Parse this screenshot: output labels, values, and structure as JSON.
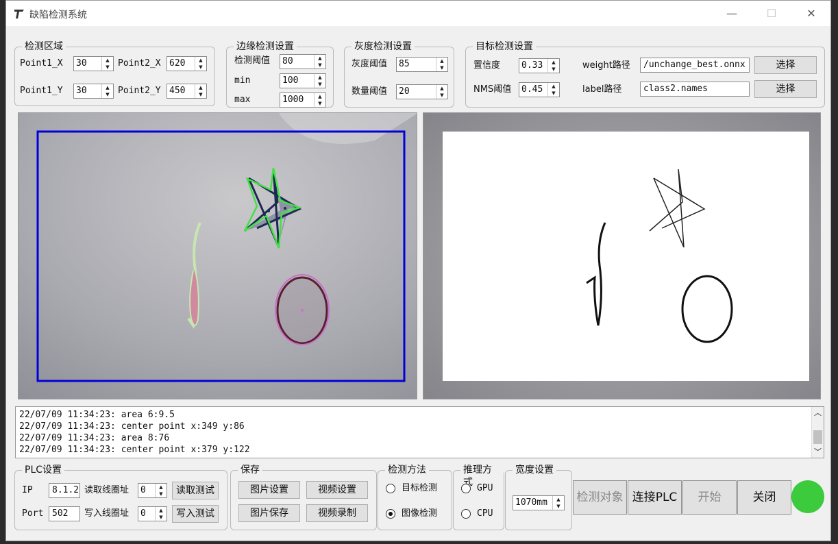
{
  "window": {
    "title": "缺陷检测系统",
    "min_glyph": "—",
    "max_glyph": "☐",
    "close_glyph": "✕"
  },
  "region": {
    "title": "检测区域",
    "p1x_label": "Point1_X",
    "p1x_value": "30",
    "p2x_label": "Point2_X",
    "p2x_value": "620",
    "p1y_label": "Point1_Y",
    "p1y_value": "30",
    "p2y_label": "Point2_Y",
    "p2y_value": "450"
  },
  "edge": {
    "title": "边缘检测设置",
    "thresh_label": "检测阈值",
    "thresh_value": "80",
    "min_label": "min",
    "min_value": "100",
    "max_label": "max",
    "max_value": "1000"
  },
  "gray": {
    "title": "灰度检测设置",
    "thresh_label": "灰度阈值",
    "thresh_value": "85",
    "count_label": "数量阈值",
    "count_value": "20"
  },
  "target": {
    "title": "目标检测设置",
    "conf_label": "置信度",
    "conf_value": "0.33",
    "nms_label": "NMS阈值",
    "nms_value": "0.45",
    "weight_label": "weight路径",
    "weight_value": "/unchange_best.onnx",
    "label_label": "label路径",
    "label_value": "class2.names",
    "select_label": "选择"
  },
  "log": {
    "lines": [
      "22/07/09 11:34:23: area 6:9.5",
      "22/07/09 11:34:23: center point x:349 y:86",
      "22/07/09 11:34:23: area 8:76",
      "22/07/09 11:34:23: center point x:379 y:122"
    ]
  },
  "plc": {
    "title": "PLC设置",
    "ip_label": "IP",
    "ip_value": "8.1.2",
    "read_label": "读取线圈址",
    "read_value": "0",
    "read_btn": "读取测试",
    "port_label": "Port",
    "port_value": "502",
    "write_label": "写入线圈址",
    "write_value": "0",
    "write_btn": "写入测试"
  },
  "save": {
    "title": "保存",
    "img_settings": "图片设置",
    "video_settings": "视频设置",
    "img_save": "图片保存",
    "video_record": "视频录制"
  },
  "method": {
    "title": "检测方法",
    "target": "目标检测",
    "image": "图像检测",
    "selected": "image"
  },
  "infer": {
    "title": "推理方式",
    "gpu": "GPU",
    "cpu": "CPU"
  },
  "width": {
    "title": "宽度设置",
    "value": "1070mm"
  },
  "actions": {
    "detect": "检测对象",
    "connect": "连接PLC",
    "start": "开始",
    "close": "关闭"
  },
  "colors": {
    "status": "#3ccb3c",
    "roi": "#0000dd",
    "accent_green": "#44e044",
    "accent_pink": "#c86fc8"
  }
}
